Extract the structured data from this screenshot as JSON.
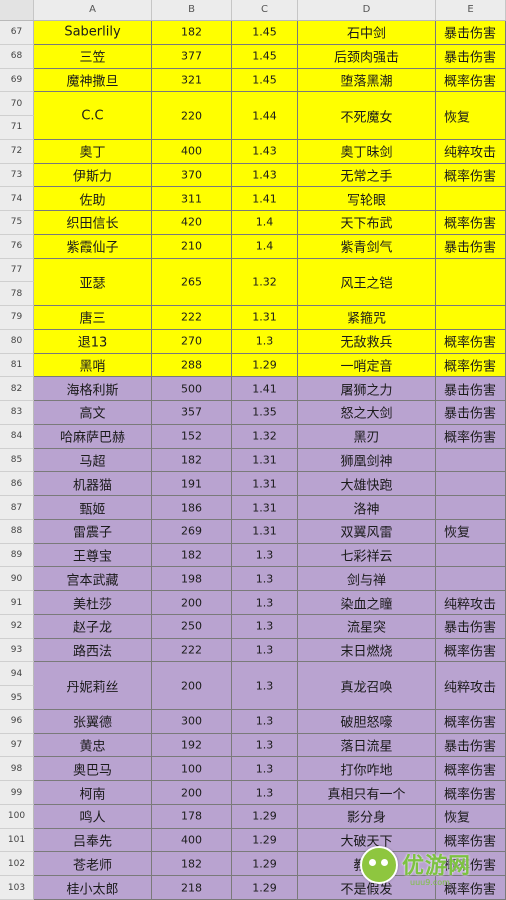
{
  "columns": [
    "A",
    "B",
    "C",
    "D",
    "E"
  ],
  "colors": {
    "yellow_fill": "#ffff00",
    "purple_fill": "#b9a3d0",
    "watermark_green": "#7dc242"
  },
  "rows": [
    {
      "nums": [
        "67"
      ],
      "hero": "Saberlily",
      "value": "182",
      "ratio": "1.45",
      "weapon": "石中剑",
      "effect": "暴击伤害",
      "fill": "yellow"
    },
    {
      "nums": [
        "68"
      ],
      "hero": "三笠",
      "value": "377",
      "ratio": "1.45",
      "weapon": "后颈肉强击",
      "effect": "暴击伤害",
      "fill": "yellow"
    },
    {
      "nums": [
        "69"
      ],
      "hero": "魔神撒旦",
      "value": "321",
      "ratio": "1.45",
      "weapon": "堕落黑潮",
      "effect": "概率伤害",
      "fill": "yellow"
    },
    {
      "nums": [
        "70",
        "71"
      ],
      "hero": "C.C",
      "value": "220",
      "ratio": "1.44",
      "weapon": "不死魔女",
      "effect": "恢复",
      "fill": "yellow"
    },
    {
      "nums": [
        "72"
      ],
      "hero": "奥丁",
      "value": "400",
      "ratio": "1.43",
      "weapon": "奥丁昧剑",
      "effect": "纯粹攻击",
      "fill": "yellow"
    },
    {
      "nums": [
        "73"
      ],
      "hero": "伊斯力",
      "value": "370",
      "ratio": "1.43",
      "weapon": "无常之手",
      "effect": "概率伤害",
      "fill": "yellow"
    },
    {
      "nums": [
        "74"
      ],
      "hero": "佐助",
      "value": "311",
      "ratio": "1.41",
      "weapon": "写轮眼",
      "effect": "",
      "fill": "yellow"
    },
    {
      "nums": [
        "75"
      ],
      "hero": "织田信长",
      "value": "420",
      "ratio": "1.4",
      "weapon": "天下布武",
      "effect": "概率伤害",
      "fill": "yellow"
    },
    {
      "nums": [
        "76"
      ],
      "hero": "紫霞仙子",
      "value": "210",
      "ratio": "1.4",
      "weapon": "紫青剑气",
      "effect": "暴击伤害",
      "fill": "yellow"
    },
    {
      "nums": [
        "77",
        "78"
      ],
      "hero": "亚瑟",
      "value": "265",
      "ratio": "1.32",
      "weapon": "风王之铠",
      "effect": "",
      "fill": "yellow"
    },
    {
      "nums": [
        "79"
      ],
      "hero": "唐三",
      "value": "222",
      "ratio": "1.31",
      "weapon": "紧箍咒",
      "effect": "",
      "fill": "yellow"
    },
    {
      "nums": [
        "80"
      ],
      "hero": "退13",
      "value": "270",
      "ratio": "1.3",
      "weapon": "无敌救兵",
      "effect": "概率伤害",
      "fill": "yellow"
    },
    {
      "nums": [
        "81"
      ],
      "hero": "黑哨",
      "value": "288",
      "ratio": "1.29",
      "weapon": "一哨定音",
      "effect": "概率伤害",
      "fill": "yellow"
    },
    {
      "nums": [
        "82"
      ],
      "hero": "海格利斯",
      "value": "500",
      "ratio": "1.41",
      "weapon": "屠狮之力",
      "effect": "暴击伤害",
      "fill": "purple"
    },
    {
      "nums": [
        "83"
      ],
      "hero": "高文",
      "value": "357",
      "ratio": "1.35",
      "weapon": "怒之大剑",
      "effect": "暴击伤害",
      "fill": "purple"
    },
    {
      "nums": [
        "84"
      ],
      "hero": "哈麻萨巴赫",
      "value": "152",
      "ratio": "1.32",
      "weapon": "黑刃",
      "effect": "概率伤害",
      "fill": "purple"
    },
    {
      "nums": [
        "85"
      ],
      "hero": "马超",
      "value": "182",
      "ratio": "1.31",
      "weapon": "狮凰剑神",
      "effect": "",
      "fill": "purple"
    },
    {
      "nums": [
        "86"
      ],
      "hero": "机器猫",
      "value": "191",
      "ratio": "1.31",
      "weapon": "大雄快跑",
      "effect": "",
      "fill": "purple"
    },
    {
      "nums": [
        "87"
      ],
      "hero": "甄姬",
      "value": "186",
      "ratio": "1.31",
      "weapon": "洛神",
      "effect": "",
      "fill": "purple"
    },
    {
      "nums": [
        "88"
      ],
      "hero": "雷震子",
      "value": "269",
      "ratio": "1.31",
      "weapon": "双翼风雷",
      "effect": "恢复",
      "fill": "purple"
    },
    {
      "nums": [
        "89"
      ],
      "hero": "王尊宝",
      "value": "182",
      "ratio": "1.3",
      "weapon": "七彩祥云",
      "effect": "",
      "fill": "purple"
    },
    {
      "nums": [
        "90"
      ],
      "hero": "宫本武藏",
      "value": "198",
      "ratio": "1.3",
      "weapon": "剑与禅",
      "effect": "",
      "fill": "purple"
    },
    {
      "nums": [
        "91"
      ],
      "hero": "美杜莎",
      "value": "200",
      "ratio": "1.3",
      "weapon": "染血之瞳",
      "effect": "纯粹攻击",
      "fill": "purple"
    },
    {
      "nums": [
        "92"
      ],
      "hero": "赵子龙",
      "value": "250",
      "ratio": "1.3",
      "weapon": "流星突",
      "effect": "暴击伤害",
      "fill": "purple"
    },
    {
      "nums": [
        "93"
      ],
      "hero": "路西法",
      "value": "222",
      "ratio": "1.3",
      "weapon": "末日燃烧",
      "effect": "概率伤害",
      "fill": "purple"
    },
    {
      "nums": [
        "94",
        "95"
      ],
      "hero": "丹妮莉丝",
      "value": "200",
      "ratio": "1.3",
      "weapon": "真龙召唤",
      "effect": "纯粹攻击",
      "fill": "purple"
    },
    {
      "nums": [
        "96"
      ],
      "hero": "张翼德",
      "value": "300",
      "ratio": "1.3",
      "weapon": "破胆怒嚎",
      "effect": "概率伤害",
      "fill": "purple"
    },
    {
      "nums": [
        "97"
      ],
      "hero": "黄忠",
      "value": "192",
      "ratio": "1.3",
      "weapon": "落日流星",
      "effect": "暴击伤害",
      "fill": "purple"
    },
    {
      "nums": [
        "98"
      ],
      "hero": "奥巴马",
      "value": "100",
      "ratio": "1.3",
      "weapon": "打你咋地",
      "effect": "概率伤害",
      "fill": "purple"
    },
    {
      "nums": [
        "99"
      ],
      "hero": "柯南",
      "value": "200",
      "ratio": "1.3",
      "weapon": "真相只有一个",
      "effect": "概率伤害",
      "fill": "purple"
    },
    {
      "nums": [
        "100"
      ],
      "hero": "鸣人",
      "value": "178",
      "ratio": "1.29",
      "weapon": "影分身",
      "effect": "恢复",
      "fill": "purple"
    },
    {
      "nums": [
        "101"
      ],
      "hero": "吕奉先",
      "value": "400",
      "ratio": "1.29",
      "weapon": "大破天下",
      "effect": "概率伤害",
      "fill": "purple"
    },
    {
      "nums": [
        "102"
      ],
      "hero": "苍老师",
      "value": "182",
      "ratio": "1.29",
      "weapon": "教育",
      "effect": "概率伤害",
      "fill": "purple"
    },
    {
      "nums": [
        "103"
      ],
      "hero": "桂小太郎",
      "value": "218",
      "ratio": "1.29",
      "weapon": "不是假发",
      "effect": "概率伤害",
      "fill": "purple"
    }
  ],
  "watermark": {
    "brand": "优游网",
    "sub": "uuu9.com"
  }
}
